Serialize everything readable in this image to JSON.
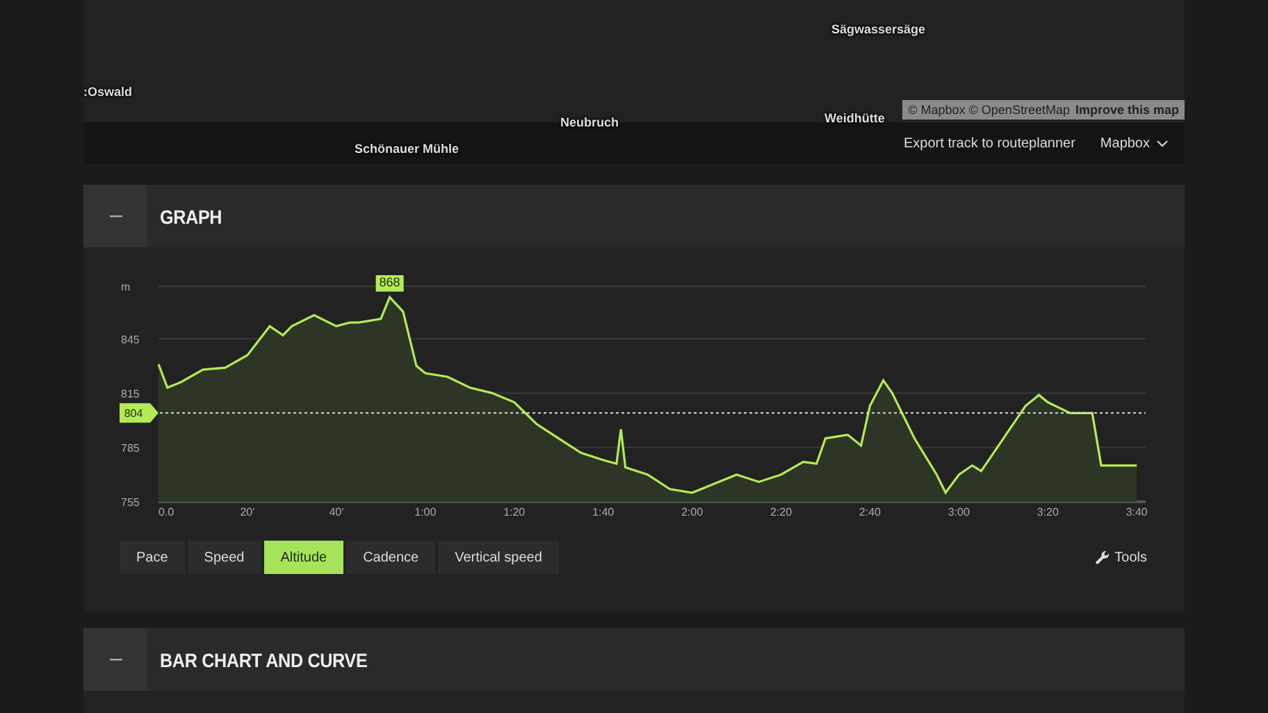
{
  "map": {
    "labels": [
      {
        "text": "Sägwassersäge"
      },
      {
        "text": ":Oswald"
      },
      {
        "text": "Neubruch"
      },
      {
        "text": "Weidhütte"
      },
      {
        "text": "Schönauer Mühle"
      }
    ],
    "attribution": "© Mapbox © OpenStreetMap",
    "improve_link": "Improve this map",
    "export_link": "Export track to routeplanner",
    "style_dropdown": "Mapbox"
  },
  "panels": [
    {
      "title": "GRAPH"
    },
    {
      "title": "BAR CHART AND CURVE"
    }
  ],
  "graph": {
    "chart_data": {
      "type": "area",
      "ylabel": "m",
      "xlim": [
        0,
        222
      ],
      "ylim": [
        755,
        874
      ],
      "grid": true,
      "yticks": [
        755,
        785,
        815,
        845
      ],
      "xticks": [
        {
          "value": 0,
          "label": "0.0"
        },
        {
          "value": 20,
          "label": "20'"
        },
        {
          "value": 40,
          "label": "40'"
        },
        {
          "value": 60,
          "label": "1:00"
        },
        {
          "value": 80,
          "label": "1:20"
        },
        {
          "value": 100,
          "label": "1:40"
        },
        {
          "value": 120,
          "label": "2:00"
        },
        {
          "value": 140,
          "label": "2:20"
        },
        {
          "value": 160,
          "label": "2:40"
        },
        {
          "value": 180,
          "label": "3:00"
        },
        {
          "value": 200,
          "label": "3:20"
        },
        {
          "value": 220,
          "label": "3:40"
        }
      ],
      "x": [
        0,
        2,
        5,
        10,
        15,
        20,
        25,
        28,
        30,
        35,
        40,
        43,
        45,
        50,
        52,
        55,
        58,
        60,
        65,
        70,
        75,
        80,
        85,
        90,
        95,
        100,
        103,
        104,
        105,
        110,
        115,
        120,
        125,
        130,
        135,
        140,
        145,
        148,
        150,
        155,
        158,
        160,
        163,
        165,
        170,
        175,
        177,
        180,
        183,
        185,
        190,
        195,
        198,
        200,
        205,
        210,
        212,
        220
      ],
      "series": [
        {
          "color": "#b4eb55",
          "values": [
            831,
            818,
            821,
            828,
            829,
            836,
            852,
            847,
            852,
            858,
            852,
            854,
            854,
            856,
            868,
            860,
            830,
            826,
            824,
            818,
            815,
            810,
            798,
            790,
            782,
            778,
            776,
            795,
            774,
            770,
            762,
            760,
            765,
            770,
            766,
            770,
            777,
            776,
            790,
            792,
            786,
            808,
            822,
            815,
            790,
            770,
            760,
            770,
            775,
            772,
            790,
            808,
            814,
            810,
            804,
            804,
            775,
            775
          ]
        }
      ],
      "annotations": [
        {
          "text": "868",
          "x": 52,
          "y": 868
        }
      ],
      "ref_lines": [
        {
          "axis": "y",
          "value": 804,
          "label": "804"
        }
      ]
    }
  },
  "graph_tabs": [
    {
      "label": "Pace",
      "selected": false
    },
    {
      "label": "Speed",
      "selected": false
    },
    {
      "label": "Altitude",
      "selected": true
    },
    {
      "label": "Cadence",
      "selected": false
    },
    {
      "label": "Vertical speed",
      "selected": false
    }
  ],
  "tools_button": "Tools"
}
